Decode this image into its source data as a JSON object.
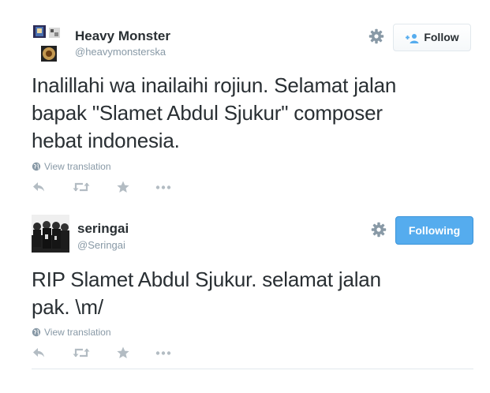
{
  "tweets": [
    {
      "name": "Heavy Monster",
      "handle": "@heavymonsterska",
      "text_lines": [
        "Inalillahi wa inailaihi rojiun. Selamat jalan",
        "bapak \"Slamet Abdul Sjukur\" composer",
        "hebat indonesia."
      ],
      "translate_label": "View translation",
      "follow_label": "Follow",
      "follow_state": "not-following"
    },
    {
      "name": "seringai",
      "handle": "@Seringai",
      "text_lines": [
        "RIP Slamet Abdul Sjukur. selamat jalan",
        "pak. \\m/"
      ],
      "translate_label": "View translation",
      "follow_label": "Following",
      "follow_state": "following"
    }
  ],
  "colors": {
    "text": "#292f33",
    "muted": "#8899a6",
    "action_icon": "#b3bcc3",
    "following_blue": "#55acee",
    "divider": "#e1e8ed"
  },
  "icons": {
    "settings": "gear-icon",
    "follow": "person-plus-icon",
    "translate": "globe-icon",
    "reply": "reply-icon",
    "retweet": "retweet-icon",
    "favorite": "star-icon",
    "more": "more-dots-icon"
  }
}
